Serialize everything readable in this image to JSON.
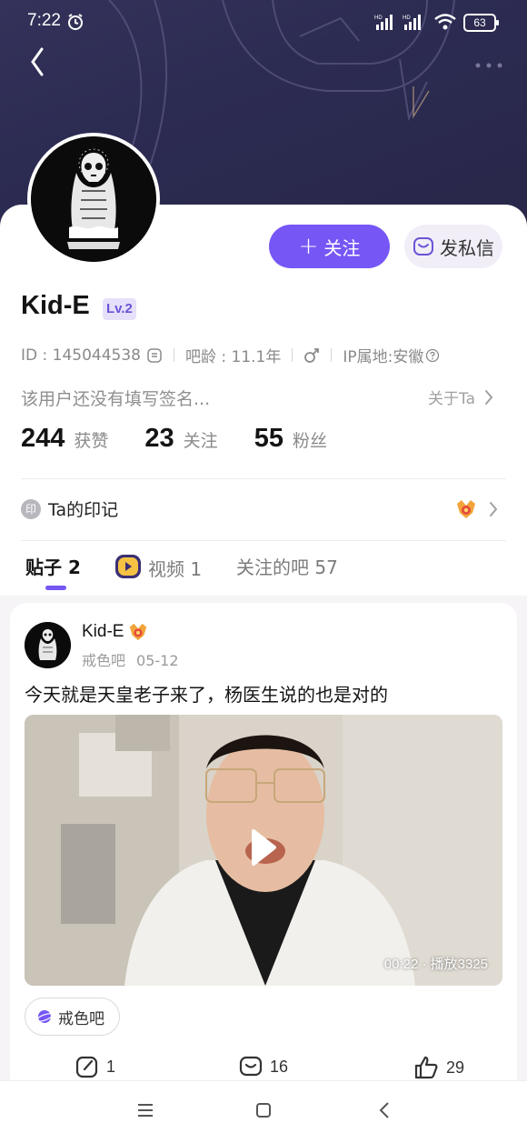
{
  "status_bar": {
    "time": "7:22",
    "battery": "63",
    "hd1": "HD",
    "hd2": "HD"
  },
  "profile": {
    "username": "Kid-E",
    "level": "Lv.2",
    "id_label": "ID : 145044538",
    "forum_age": "吧龄 : 11.1年",
    "gender_icon": "male-icon",
    "ip_location": "IP属地:安徽",
    "signature": "该用户还没有填写签名...",
    "about_label": "关于Ta",
    "follow_label": "关注",
    "message_label": "发私信",
    "stats": [
      {
        "value": "244",
        "label": "获赞"
      },
      {
        "value": "23",
        "label": "关注"
      },
      {
        "value": "55",
        "label": "粉丝"
      }
    ],
    "imprint_badge": "印",
    "imprint_label": "Ta的印记"
  },
  "tabs": [
    {
      "label": "贴子 2",
      "active": true
    },
    {
      "label": "视频 1",
      "active": false
    },
    {
      "label": "关注的吧 57",
      "active": false
    }
  ],
  "post": {
    "author": "Kid-E",
    "forum": "戒色吧",
    "date": "05-12",
    "text": "今天就是天皇老子来了，杨医生说的也是对的",
    "video_duration": "00:22 · 播放3325",
    "forum_tag": "戒色吧",
    "comments": "1",
    "reactions": "16",
    "likes": "29"
  },
  "colors": {
    "accent": "#7656f5",
    "banner": "#2c2b52"
  }
}
